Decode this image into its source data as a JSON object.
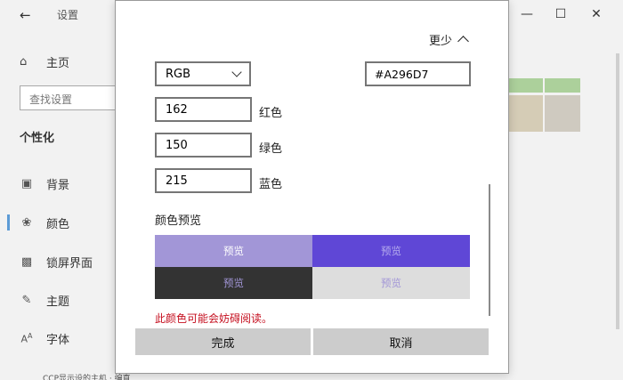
{
  "settings": {
    "title": "设置",
    "back_icon": "back-arrow-icon",
    "home_label": "主页",
    "search_placeholder": "查找设置",
    "section": "个性化",
    "nav": [
      {
        "label": "背景",
        "icon": "picture-icon"
      },
      {
        "label": "颜色",
        "icon": "palette-icon",
        "selected": true
      },
      {
        "label": "锁屏界面",
        "icon": "lockscreen-icon"
      },
      {
        "label": "主题",
        "icon": "theme-icon"
      },
      {
        "label": "字体",
        "icon": "font-icon"
      }
    ],
    "taskbar_text": "CCP显示设的主机 · 编直",
    "window_controls": [
      "minimize",
      "maximize",
      "close"
    ]
  },
  "dialog": {
    "less_label": "更少",
    "color_mode": "RGB",
    "hex_value": "#A296D7",
    "red": {
      "value": "162",
      "label": "红色"
    },
    "green": {
      "value": "150",
      "label": "绿色"
    },
    "blue": {
      "value": "215",
      "label": "蓝色"
    },
    "preview_title": "颜色预览",
    "preview_text": "预览",
    "warning": "此颜色可能会妨碍阅读。",
    "done_label": "完成",
    "cancel_label": "取消"
  },
  "colors": {
    "chosen": "#A296D7",
    "accent": "#5F47D6",
    "dark": "#333333",
    "light": "#DDDDDD",
    "warning": "#C50F1F"
  }
}
